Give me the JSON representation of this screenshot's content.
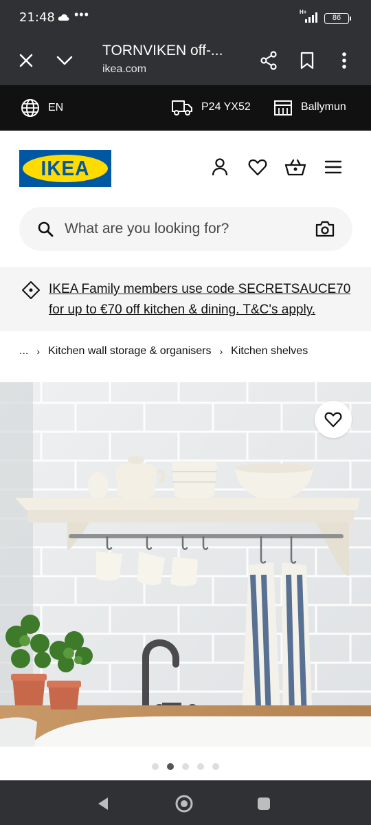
{
  "status_bar": {
    "time": "21:48",
    "network": "H+",
    "battery": "86",
    "more": "•••"
  },
  "browser": {
    "title": "TORNVIKEN off-...",
    "url": "ikea.com"
  },
  "utility_bar": {
    "language": "EN",
    "postcode": "P24 YX52",
    "store": "Ballymun"
  },
  "header": {
    "logo_text": "IKEA"
  },
  "search": {
    "placeholder": "What are you looking for?"
  },
  "promo": {
    "text": "IKEA Family members use code SECRETSAUCE70 for up to €70 off kitchen & dining. T&C's apply."
  },
  "breadcrumb": {
    "ellipsis": "...",
    "items": [
      "Kitchen wall storage & organisers",
      "Kitchen shelves"
    ]
  },
  "carousel": {
    "total": 5,
    "active_index": 1
  },
  "colors": {
    "ikea_blue": "#0058a3",
    "ikea_yellow": "#ffdb00",
    "chrome_dark": "#303134"
  }
}
